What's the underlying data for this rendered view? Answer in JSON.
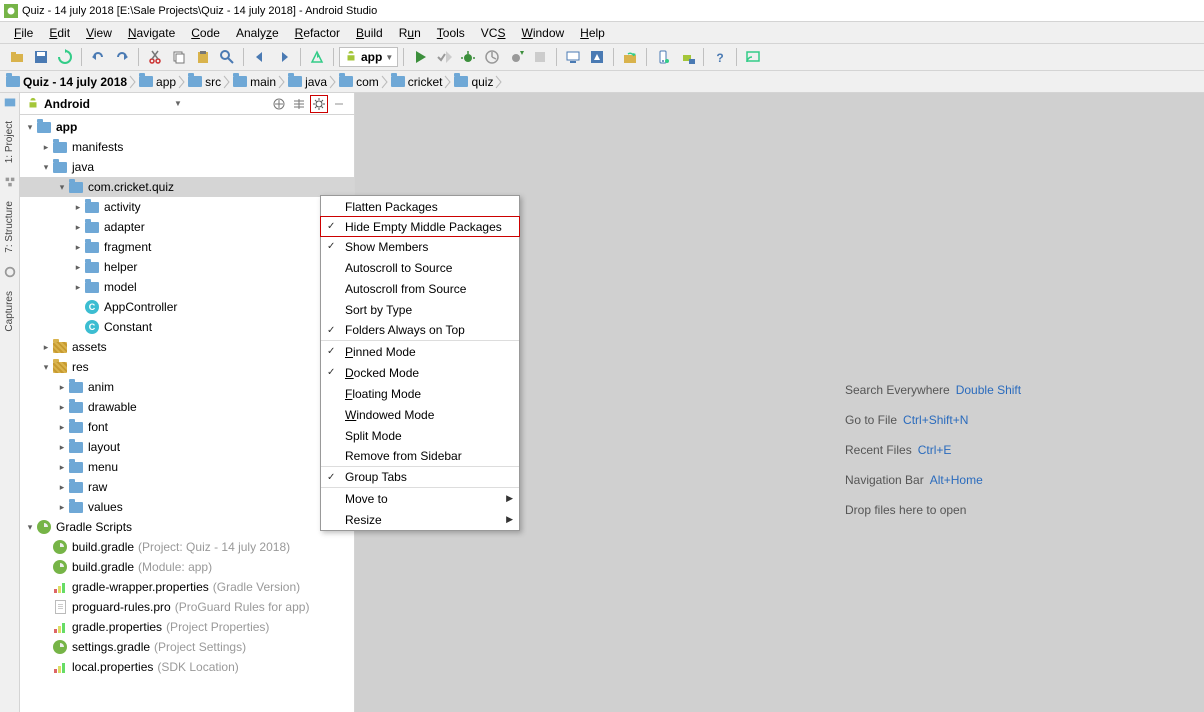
{
  "title": "Quiz - 14 july 2018 [E:\\Sale Projects\\Quiz - 14 july 2018] - Android Studio",
  "menu": [
    "File",
    "Edit",
    "View",
    "Navigate",
    "Code",
    "Analyze",
    "Refactor",
    "Build",
    "Run",
    "Tools",
    "VCS",
    "Window",
    "Help"
  ],
  "config_label": "app",
  "breadcrumb": [
    "Quiz - 14 july 2018",
    "app",
    "src",
    "main",
    "java",
    "com",
    "cricket",
    "quiz"
  ],
  "panel": {
    "view": "Android"
  },
  "tree": {
    "app": "app",
    "manifests": "manifests",
    "java": "java",
    "package": "com.cricket.quiz",
    "pkg_children": [
      "activity",
      "adapter",
      "fragment",
      "helper",
      "model"
    ],
    "appcontroller": "AppController",
    "constant": "Constant",
    "assets": "assets",
    "res": "res",
    "res_children": [
      "anim",
      "drawable",
      "font",
      "layout",
      "menu",
      "raw",
      "values"
    ],
    "gradle_scripts": "Gradle Scripts",
    "gradle_files": [
      {
        "name": "build.gradle",
        "note": "(Project: Quiz - 14 july 2018)",
        "icon": "gradle"
      },
      {
        "name": "build.gradle",
        "note": "(Module: app)",
        "icon": "gradle"
      },
      {
        "name": "gradle-wrapper.properties",
        "note": "(Gradle Version)",
        "icon": "bars"
      },
      {
        "name": "proguard-rules.pro",
        "note": "(ProGuard Rules for app)",
        "icon": "file"
      },
      {
        "name": "gradle.properties",
        "note": "(Project Properties)",
        "icon": "bars"
      },
      {
        "name": "settings.gradle",
        "note": "(Project Settings)",
        "icon": "gradle"
      },
      {
        "name": "local.properties",
        "note": "(SDK Location)",
        "icon": "bars"
      }
    ]
  },
  "context_menu": [
    {
      "label": "Flatten Packages",
      "sep": false
    },
    {
      "label": "Hide Empty Middle Packages",
      "check": true,
      "highlight": true,
      "sep": true
    },
    {
      "label": "Show Members",
      "check": true
    },
    {
      "label": "Autoscroll to Source"
    },
    {
      "label": "Autoscroll from Source"
    },
    {
      "label": "Sort by Type"
    },
    {
      "label": "Folders Always on Top",
      "check": true,
      "sep": true
    },
    {
      "label": "Pinned Mode",
      "check": true,
      "ul": 0
    },
    {
      "label": "Docked Mode",
      "check": true,
      "ul": 0
    },
    {
      "label": "Floating Mode",
      "ul": 0
    },
    {
      "label": "Windowed Mode",
      "ul": 0
    },
    {
      "label": "Split Mode"
    },
    {
      "label": "Remove from Sidebar",
      "sep": true
    },
    {
      "label": "Group Tabs",
      "check": true,
      "sep": true
    },
    {
      "label": "Move to",
      "sub": true
    },
    {
      "label": "Resize",
      "sub": true
    }
  ],
  "hints": [
    {
      "text": "Search Everywhere",
      "key": "Double Shift"
    },
    {
      "text": "Go to File",
      "key": "Ctrl+Shift+N"
    },
    {
      "text": "Recent Files",
      "key": "Ctrl+E"
    },
    {
      "text": "Navigation Bar",
      "key": "Alt+Home"
    },
    {
      "text": "Drop files here to open",
      "key": ""
    }
  ],
  "left_tabs": [
    "1: Project",
    "7: Structure",
    "Captures"
  ]
}
